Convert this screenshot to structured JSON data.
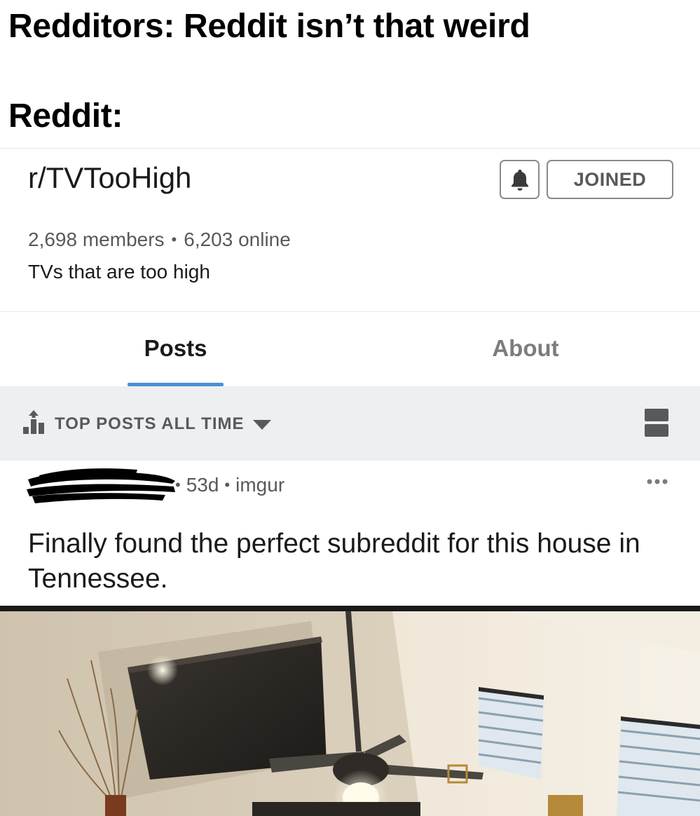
{
  "meme": {
    "caption_line1": "Redditors: Reddit isn’t that weird",
    "caption_line2": "Reddit:"
  },
  "subreddit": {
    "name": "r/TVTooHigh",
    "joined_label": "JOINED",
    "members": "2,698 members",
    "online": "6,203 online",
    "description": "TVs that are too high"
  },
  "tabs": [
    {
      "label": "Posts",
      "active": true
    },
    {
      "label": "About",
      "active": false
    }
  ],
  "sort": {
    "label": "TOP POSTS ALL TIME"
  },
  "post": {
    "age": "53d",
    "source": "imgur",
    "title": "Finally found the perfect subreddit for this house in Tennessee."
  },
  "colors": {
    "accent_blue": "#4a90d9",
    "sort_bar_bg": "#edeff1",
    "muted_text": "#58595b"
  },
  "icons": {
    "notification": "bell-icon",
    "sort": "bar-chart-arrow-icon",
    "sort_dropdown": "caret-down-icon",
    "view_mode": "card-view-icon",
    "post_menu": "more-horizontal-icon"
  }
}
